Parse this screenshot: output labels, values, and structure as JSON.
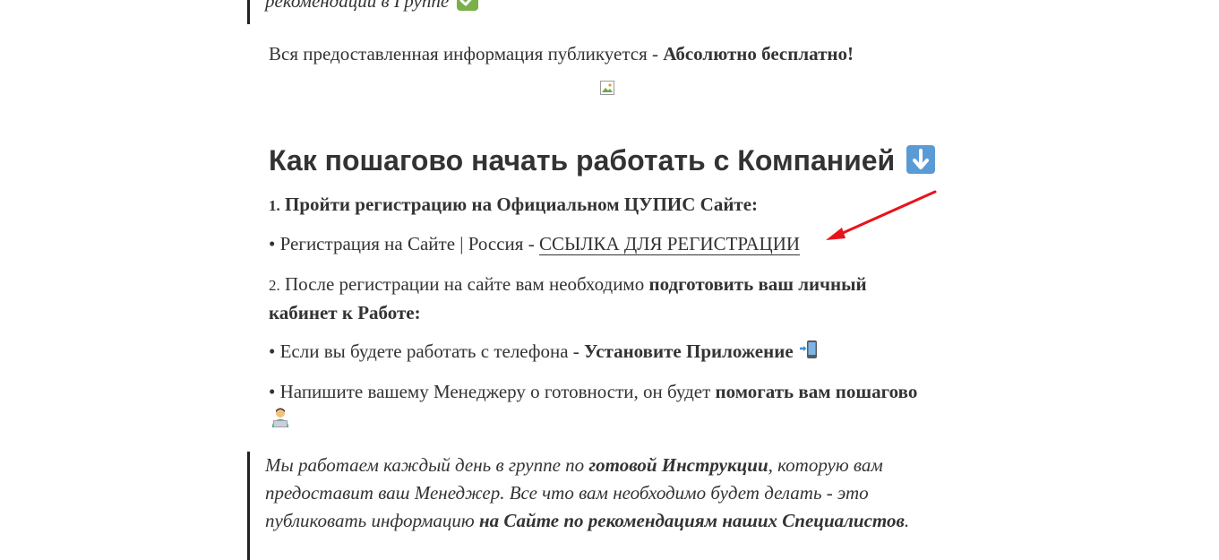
{
  "quote_top": {
    "text": "рекомендаций в Группе"
  },
  "free_info": {
    "text": "Вся предоставленная информация публикуется - ",
    "bold": "Абсолютно бесплатно",
    "end": "!"
  },
  "heading": {
    "text": "Как пошагово начать работать с Компанией"
  },
  "step1": {
    "num": "1.",
    "bold": "Пройти регистрацию на Официальном ЦУПИС Сайте:"
  },
  "bullet1": {
    "bullet": "•",
    "text": "Регистрация на Сайте | Россия - ",
    "link": "ССЫЛКА ДЛЯ РЕГИСТРАЦИИ"
  },
  "step2": {
    "num": "2.",
    "text": "После регистрации на сайте вам необходимо ",
    "bold": "подготовить ваш личный кабинет к Работе:"
  },
  "bullet2": {
    "bullet": "•",
    "text": "Если вы будете работать с телефона - ",
    "bold": "Установите Приложение"
  },
  "bullet3": {
    "bullet": "•",
    "text": "Напишите вашему Менеджеру о готовности, он будет ",
    "bold": "помогать вам пошагово"
  },
  "quote_bottom": {
    "t1": "Мы работаем каждый день в группе по ",
    "b1": "готовой Инструкции",
    "t2": ", которую вам предоставит ваш Менеджер. Все что вам необходимо будет делать - это публиковать информацию ",
    "b2": "на Сайте по рекомендациям наших Специалистов",
    "t3": "."
  },
  "icons": {
    "check": "check-mark-icon",
    "down_arrow": "down-arrow-icon",
    "phone": "mobile-phone-arrow-icon",
    "technologist": "person-at-laptop-icon",
    "red_arrow": "red-pointer-arrow"
  }
}
